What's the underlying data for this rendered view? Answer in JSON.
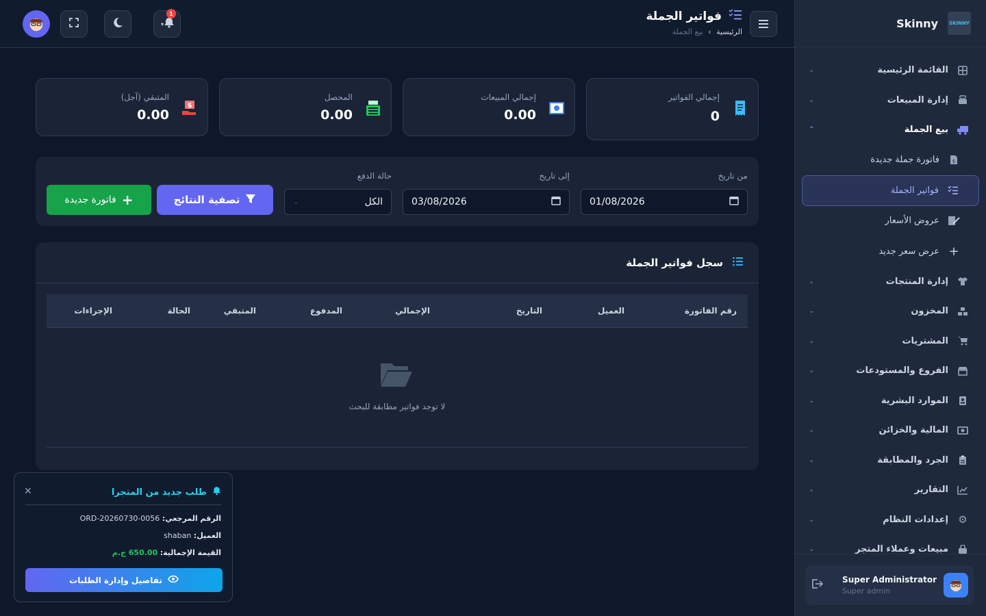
{
  "brand": {
    "name": "Skinny",
    "logo_text": "SKINNY"
  },
  "header": {
    "title": "فواتير الجملة",
    "breadcrumb_home": "الرئيسية",
    "breadcrumb_sep": "›",
    "breadcrumb_current": "بيع الجملة",
    "notification_count": "1"
  },
  "sidebar": {
    "items": [
      {
        "label": "القائمة الرئيسية",
        "icon": "grid-icon"
      },
      {
        "label": "إدارة المبيعات",
        "icon": "register-icon"
      },
      {
        "label": "بيع الجملة",
        "icon": "truck-icon",
        "open": true
      },
      {
        "label": "إدارة المنتجات",
        "icon": "shirt-icon"
      },
      {
        "label": "المخزون",
        "icon": "boxes-icon"
      },
      {
        "label": "المشتريات",
        "icon": "cart-icon"
      },
      {
        "label": "الفروع والمستودعات",
        "icon": "store-icon"
      },
      {
        "label": "الموارد البشرية",
        "icon": "id-card-icon"
      },
      {
        "label": "المالية والخزائن",
        "icon": "money-icon"
      },
      {
        "label": "الجرد والمطابقة",
        "icon": "clipboard-icon"
      },
      {
        "label": "التقارير",
        "icon": "chart-icon"
      },
      {
        "label": "إعدادات النظام",
        "icon": "gear-icon"
      },
      {
        "label": "مبيعات وعملاء المتجر",
        "icon": "bag-icon"
      }
    ],
    "sub_items": [
      {
        "label": "فاتورة جملة جديدة",
        "icon": "invoice-dollar-icon"
      },
      {
        "label": "فواتير الجملة",
        "icon": "list-check-icon",
        "active": true
      },
      {
        "label": "عروض الأسعار",
        "icon": "signature-icon"
      },
      {
        "label": "عرض سعر جديد",
        "icon": "plus-icon"
      }
    ],
    "user": {
      "name": "Super Administrator",
      "role": "Super admin"
    }
  },
  "stats": [
    {
      "label": "إجمالي الفواتير",
      "value": "0",
      "icon": "receipt-icon",
      "color": "#38bdf8"
    },
    {
      "label": "إجمالي المبيعات",
      "value": "0.00",
      "icon": "cash-icon",
      "color": "#3b82f6"
    },
    {
      "label": "المحصل",
      "value": "0.00",
      "icon": "cash-register-icon",
      "color": "#22c55e"
    },
    {
      "label": "المتبقي (آجل)",
      "value": "0.00",
      "icon": "hand-dollar-icon",
      "color": "#ef4444"
    }
  ],
  "filters": {
    "from_label": "من تاريخ",
    "from_value": "01/08/2026",
    "to_label": "إلى تاريخ",
    "to_value": "03/08/2026",
    "status_label": "حالة الدفع",
    "status_value": "الكل",
    "filter_button": "تصفية النتائج",
    "new_button": "فاتورة جديدة"
  },
  "table": {
    "title": "سجل فواتير الجملة",
    "columns": [
      "رقم الفاتورة",
      "العميل",
      "التاريخ",
      "الإجمالي",
      "المدفوع",
      "المتبقي",
      "الحالة",
      "الإجراءات"
    ],
    "empty_message": "لا توجد فواتير مطابقة للبحث"
  },
  "toast": {
    "title": "طلب جديد من المتجرا",
    "ref_label": "الرقم المرجعي:",
    "ref_value": "ORD-20260730-0056",
    "customer_label": "العميل:",
    "customer_value": "shaban",
    "total_label": "القيمة الإجمالية:",
    "total_value": "650.00 ج.م",
    "button": "تفاصيل وإدارة الطلبات"
  },
  "colors": {
    "accent": "#6366f1",
    "success": "#16a34a",
    "background": "#0f172a",
    "card": "#1a2436",
    "info": "#22d3ee"
  }
}
